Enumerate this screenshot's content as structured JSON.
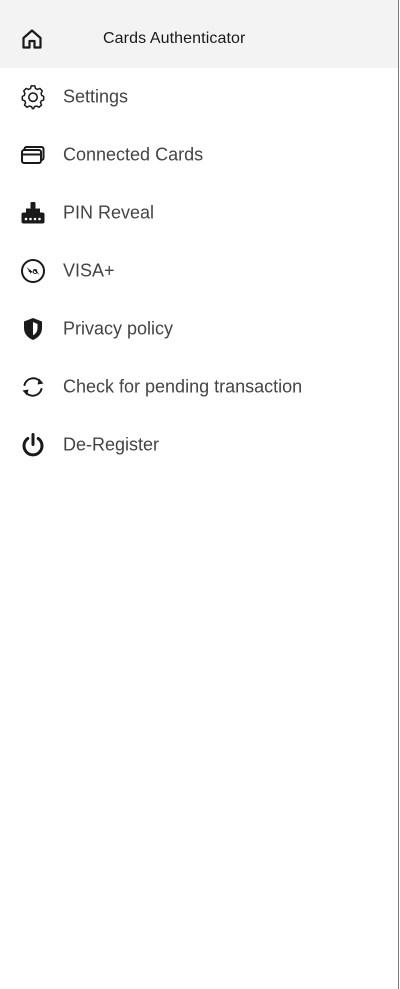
{
  "header": {
    "title": "Cards Authenticator",
    "icon": "home-icon"
  },
  "menu": {
    "items": [
      {
        "label": "Settings",
        "icon": "gear-icon"
      },
      {
        "label": "Connected Cards",
        "icon": "card-icon"
      },
      {
        "label": "PIN Reveal",
        "icon": "pin-reveal-icon"
      },
      {
        "label": "VISA+",
        "icon": "visa-plus-icon"
      },
      {
        "label": "Privacy policy",
        "icon": "shield-icon"
      },
      {
        "label": "Check for pending transaction",
        "icon": "refresh-icon"
      },
      {
        "label": "De-Register",
        "icon": "power-icon"
      }
    ]
  },
  "colors": {
    "header_bg": "#f3f3f3",
    "text": "#444444",
    "icon": "#1a1a1a"
  }
}
